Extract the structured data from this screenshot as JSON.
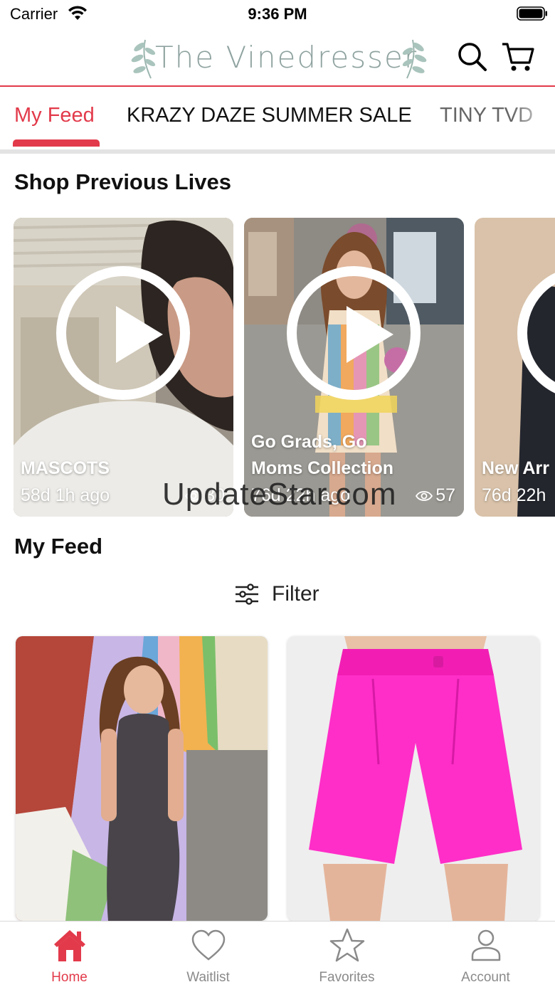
{
  "status_bar": {
    "carrier": "Carrier",
    "time": "9:36 PM"
  },
  "header": {
    "logo_text": "The Vinedresser",
    "search_icon": "search-icon",
    "cart_icon": "cart-icon",
    "accent_color": "#e23a4a"
  },
  "tabs": [
    {
      "label": "My Feed",
      "active": true
    },
    {
      "label": "KRAZY DAZE SUMMER SALE",
      "active": false
    },
    {
      "label": "TINY TVD",
      "active": false
    }
  ],
  "shop_previous_lives": {
    "title": "Shop Previous Lives",
    "items": [
      {
        "title": "MASCOTS",
        "time": "58d 1h ago",
        "views": "30"
      },
      {
        "title_line1": "Go Grads, Go",
        "title_line2": "Moms  Collection",
        "time": "76d 22h ago",
        "views": "57"
      },
      {
        "title": "New Arr",
        "time": "76d 22h"
      }
    ]
  },
  "watermark": "UpdateStar.com",
  "my_feed": {
    "title": "My Feed",
    "filter_label": "Filter"
  },
  "bottom_nav": [
    {
      "label": "Home",
      "icon": "home-icon",
      "active": true
    },
    {
      "label": "Waitlist",
      "icon": "heart-icon",
      "active": false
    },
    {
      "label": "Favorites",
      "icon": "star-icon",
      "active": false
    },
    {
      "label": "Account",
      "icon": "user-icon",
      "active": false
    }
  ]
}
